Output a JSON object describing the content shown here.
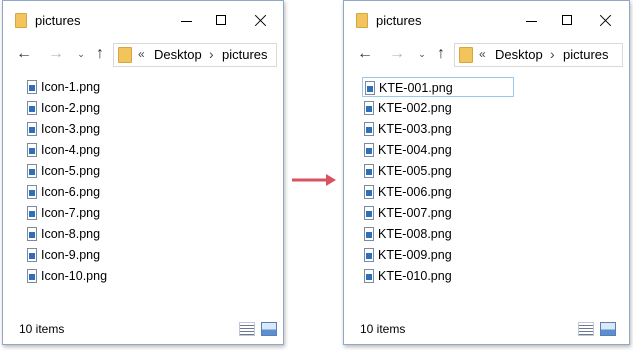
{
  "colors": {
    "accent_arrow": "#d7535f",
    "window_border": "#8fa8c8",
    "selection_border": "#99c9ef",
    "folder": "#f2c55c"
  },
  "windows": [
    {
      "title": "pictures",
      "address": {
        "chevron": "«",
        "separator": "›",
        "crumbs": [
          "Desktop",
          "pictures"
        ]
      },
      "files": [
        "Icon-1.png",
        "Icon-2.png",
        "Icon-3.png",
        "Icon-4.png",
        "Icon-5.png",
        "Icon-6.png",
        "Icon-7.png",
        "Icon-8.png",
        "Icon-9.png",
        "Icon-10.png"
      ],
      "selected_index": -1,
      "status": "10 items"
    },
    {
      "title": "pictures",
      "address": {
        "chevron": "«",
        "separator": "›",
        "crumbs": [
          "Desktop",
          "pictures"
        ]
      },
      "files": [
        "KTE-001.png",
        "KTE-002.png",
        "KTE-003.png",
        "KTE-004.png",
        "KTE-005.png",
        "KTE-006.png",
        "KTE-007.png",
        "KTE-008.png",
        "KTE-009.png",
        "KTE-010.png"
      ],
      "selected_index": 0,
      "status": "10 items"
    }
  ],
  "icons": {
    "back": "←",
    "forward": "→",
    "recent": "⌄",
    "up": "↑",
    "minimize": "minimize-icon",
    "maximize": "maximize-icon",
    "close": "close-icon",
    "arrow_between": "right-arrow-icon"
  }
}
